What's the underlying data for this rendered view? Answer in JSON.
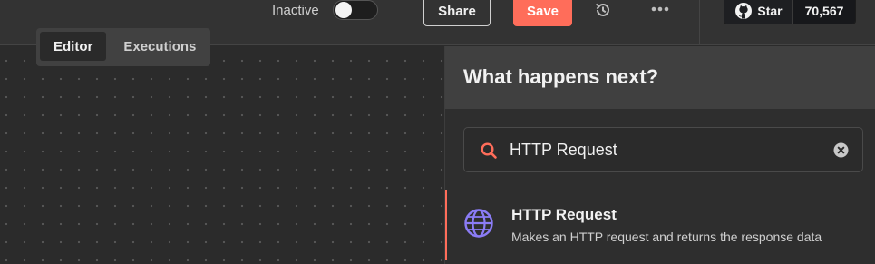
{
  "topbar": {
    "active_label": "Inactive",
    "active_toggle_on": false,
    "share_label": "Share",
    "save_label": "Save",
    "history_icon": "history-icon",
    "more_icon": "ellipsis-icon",
    "github": {
      "icon": "github-icon",
      "star_label": "Star",
      "star_count": "70,567"
    }
  },
  "tabs": [
    {
      "label": "Editor",
      "active": true
    },
    {
      "label": "Executions",
      "active": false
    }
  ],
  "panel": {
    "title": "What happens next?",
    "search": {
      "icon": "search-icon",
      "value": "HTTP Request",
      "clear_icon": "clear-icon"
    },
    "results": [
      {
        "icon": "globe-icon",
        "title": "HTTP Request",
        "description": "Makes an HTTP request and returns the response data"
      }
    ]
  },
  "colors": {
    "accent": "#ff6d5a",
    "globe": "#8b7cf6",
    "background": "#2b2b2b",
    "panel_header": "#404040"
  }
}
